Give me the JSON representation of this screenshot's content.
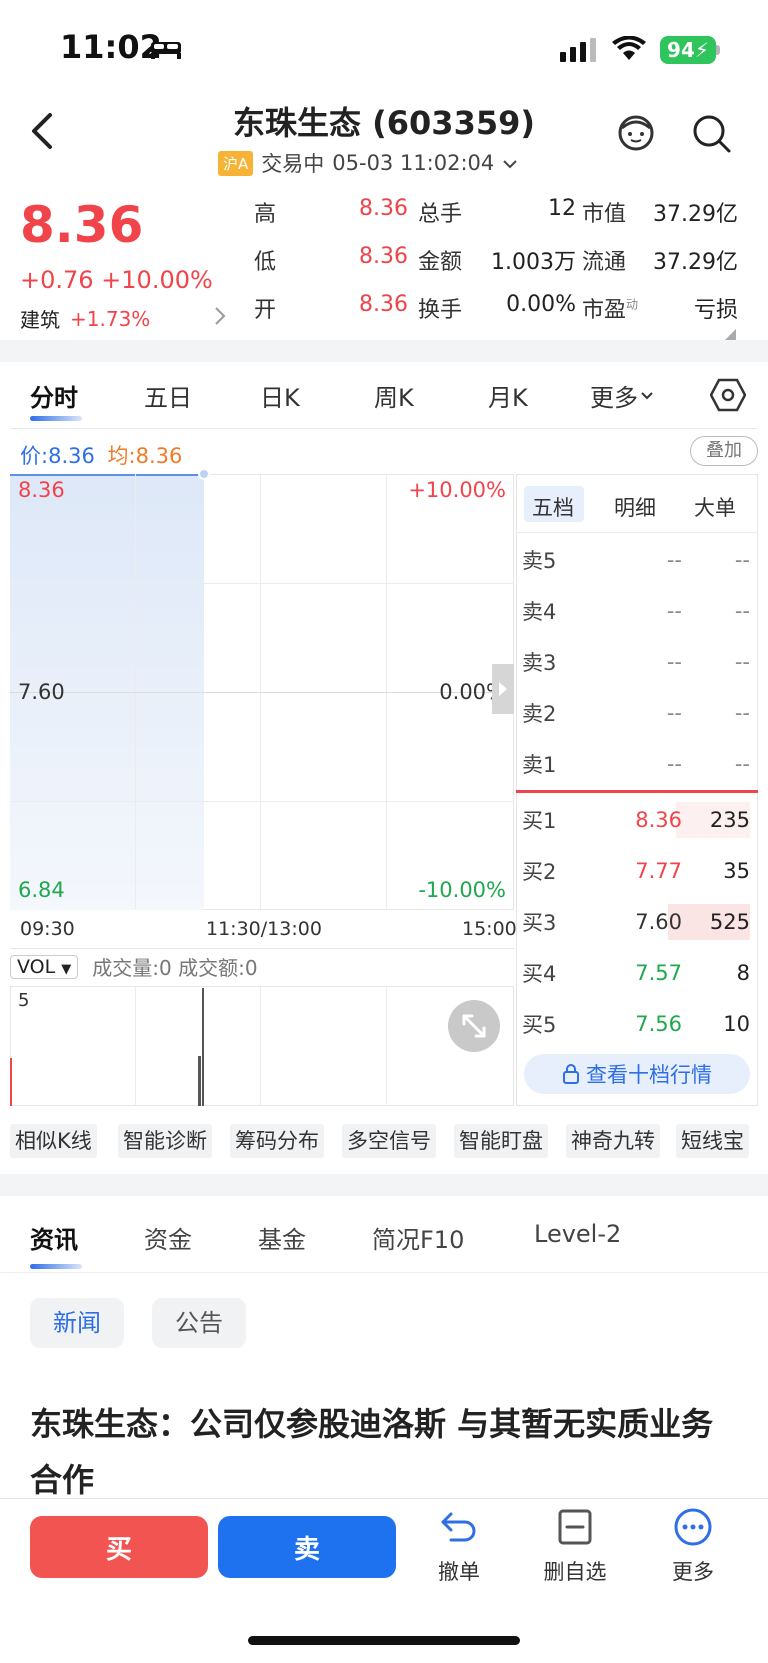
{
  "status_bar": {
    "time": "11:02",
    "battery": "94"
  },
  "header": {
    "title": "东珠生态 (603359)",
    "market_badge": "沪A",
    "trade_status": "交易中",
    "datetime": "05-03 11:02:04"
  },
  "quote": {
    "price": "8.36",
    "change": "+0.76 +10.00%",
    "sector_name": "建筑",
    "sector_change": "+1.73%",
    "fields": [
      {
        "label": "高",
        "value": "8.36"
      },
      {
        "label": "低",
        "value": "8.36"
      },
      {
        "label": "开",
        "value": "8.36"
      },
      {
        "label": "总手",
        "value": "12"
      },
      {
        "label": "金额",
        "value": "1.003万"
      },
      {
        "label": "换手",
        "value": "0.00%"
      },
      {
        "label": "市值",
        "value": "37.29亿"
      },
      {
        "label": "流通",
        "value": "37.29亿"
      },
      {
        "label": "市盈",
        "sup": "动",
        "value": "亏损"
      }
    ]
  },
  "chart_tabs": [
    "分时",
    "五日",
    "日K",
    "周K",
    "月K",
    "更多"
  ],
  "price_line": {
    "price_label": "价:",
    "price": "8.36",
    "avg_label": "均:",
    "avg": "8.36"
  },
  "overlay_label": "叠加",
  "chart": {
    "y_high": "8.36",
    "y_mid": "7.60",
    "y_low": "6.84",
    "pct_high": "+10.00%",
    "pct_mid": "0.00%",
    "pct_low": "-10.00%",
    "times": [
      "09:30",
      "11:30/13:00",
      "15:00"
    ]
  },
  "volume": {
    "indicator": "VOL",
    "summary": "成交量:0 成交额:0",
    "axis_max": "5"
  },
  "order_book": {
    "tabs": [
      "五档",
      "明细",
      "大单"
    ],
    "asks": [
      {
        "label": "卖5",
        "price": "--",
        "vol": "--"
      },
      {
        "label": "卖4",
        "price": "--",
        "vol": "--"
      },
      {
        "label": "卖3",
        "price": "--",
        "vol": "--"
      },
      {
        "label": "卖2",
        "price": "--",
        "vol": "--"
      },
      {
        "label": "卖1",
        "price": "--",
        "vol": "--"
      }
    ],
    "bids": [
      {
        "label": "买1",
        "price": "8.36",
        "vol": "235"
      },
      {
        "label": "买2",
        "price": "7.77",
        "vol": "35"
      },
      {
        "label": "买3",
        "price": "7.60",
        "vol": "525"
      },
      {
        "label": "买4",
        "price": "7.57",
        "vol": "8"
      },
      {
        "label": "买5",
        "price": "7.56",
        "vol": "10"
      }
    ],
    "ten_level_label": "查看十档行情"
  },
  "tools": [
    "相似K线",
    "智能诊断",
    "筹码分布",
    "多空信号",
    "智能盯盘",
    "神奇九转",
    "短线宝"
  ],
  "info_tabs": [
    "资讯",
    "资金",
    "基金",
    "简况F10",
    "Level-2"
  ],
  "news_filters": [
    "新闻",
    "公告"
  ],
  "headline": "东珠生态：公司仅参股迪洛斯 与其暂无实质业务合作",
  "bottom_bar": {
    "buy": "买",
    "sell": "卖",
    "cancel": "撤单",
    "remove_watch": "删自选",
    "more": "更多"
  },
  "colors": {
    "up": "#f0444a",
    "down": "#1fa84d",
    "accent": "#2e6fe6"
  }
}
